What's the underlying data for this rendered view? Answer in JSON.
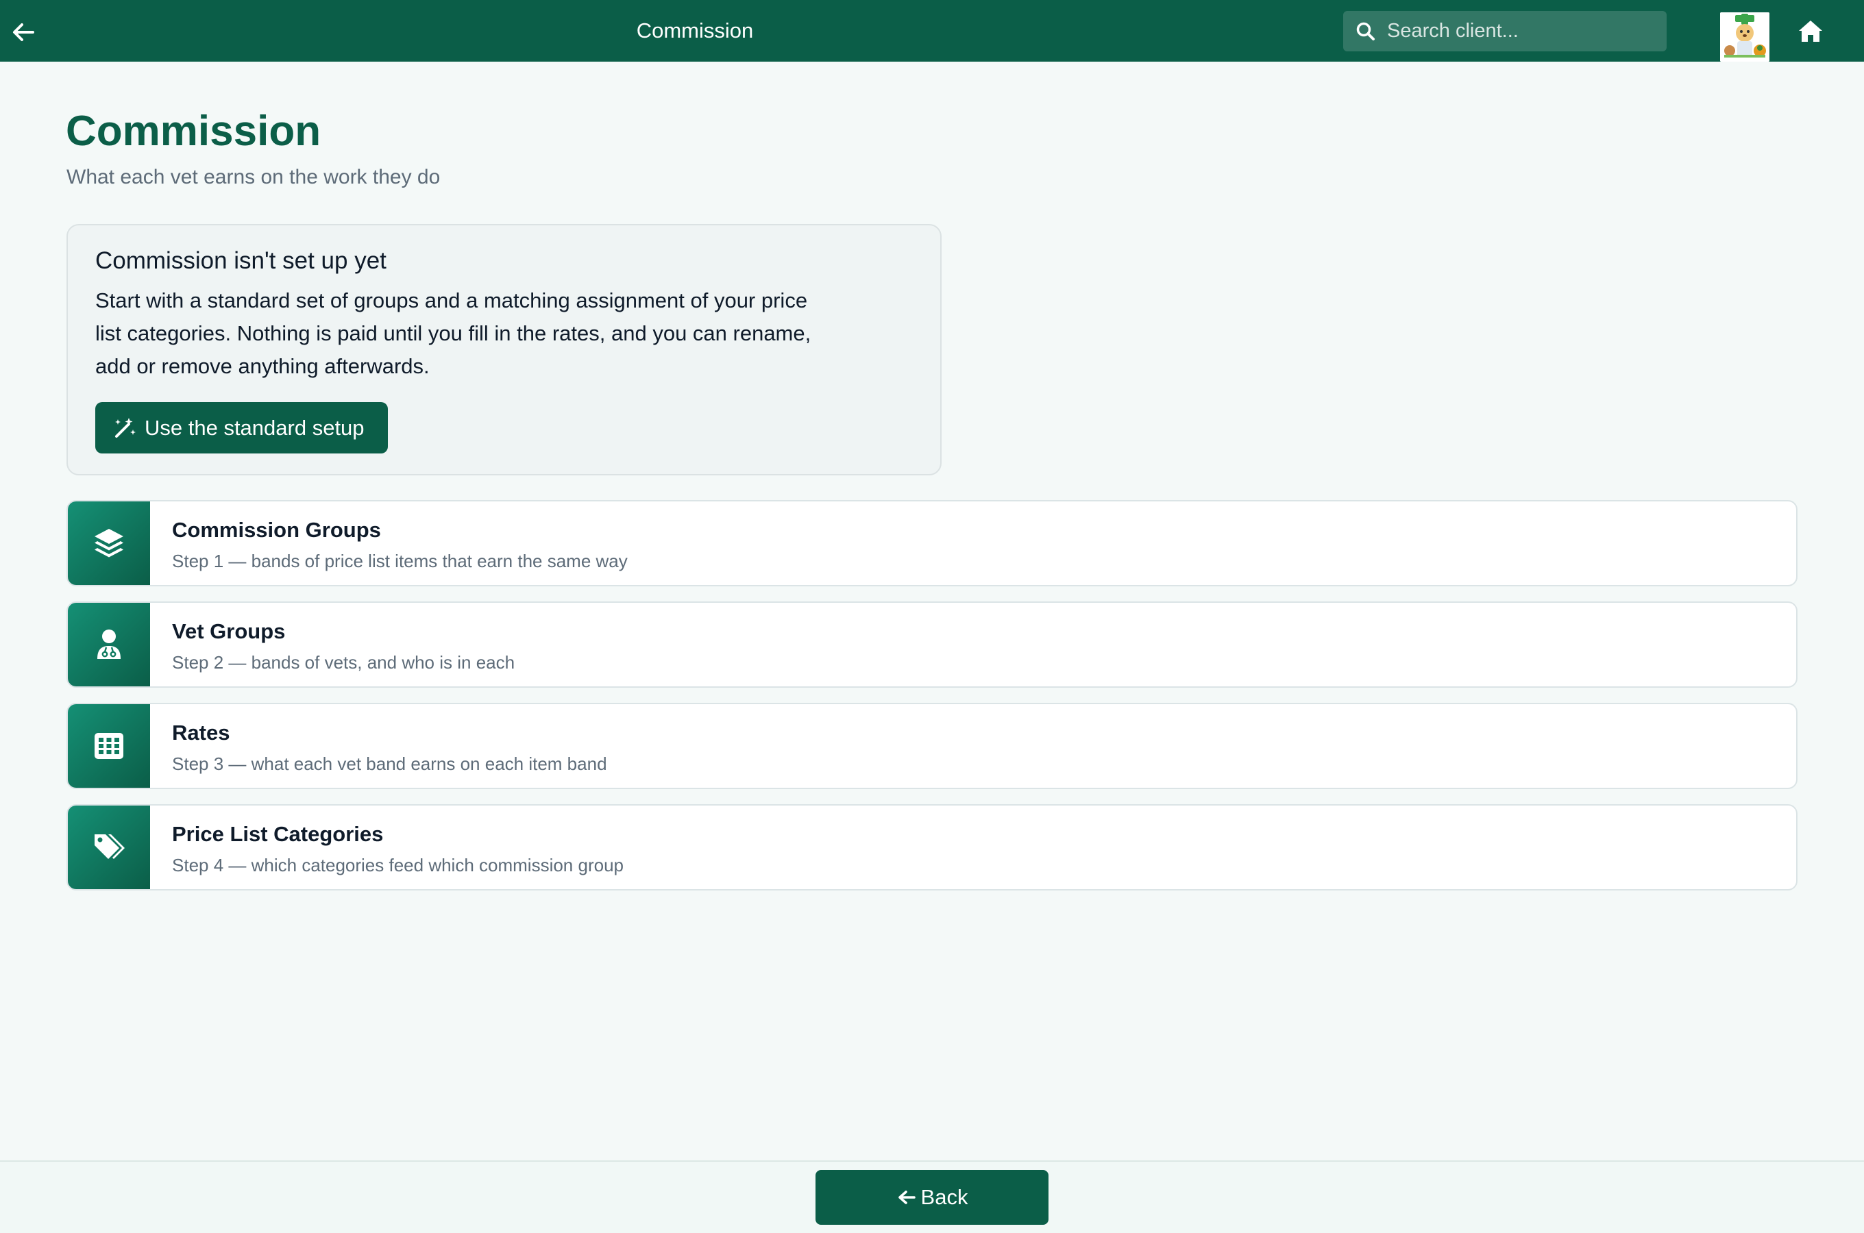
{
  "topbar": {
    "title": "Commission",
    "search_placeholder": "Search client...",
    "back_icon": "arrow-left-icon",
    "home_icon": "home-icon",
    "background": "#0b5e48"
  },
  "page": {
    "title": "Commission",
    "subtitle": "What each vet earns on the work they do"
  },
  "setup_card": {
    "title": "Commission isn't set up yet",
    "description": "Start with a standard set of groups and a matching assignment of your price list categories. Nothing is paid until you fill in the rates, and you can rename, add or remove anything afterwards.",
    "button_label": "Use the standard setup",
    "button_icon": "magic-wand-icon"
  },
  "steps": [
    {
      "title": "Commission Groups",
      "subtitle": "Step 1 — bands of price list items that earn the same way",
      "icon": "layers-icon"
    },
    {
      "title": "Vet Groups",
      "subtitle": "Step 2 — bands of vets, and who is in each",
      "icon": "vet-user-icon"
    },
    {
      "title": "Rates",
      "subtitle": "Step 3 — what each vet band earns on each item band",
      "icon": "grid-icon"
    },
    {
      "title": "Price List Categories",
      "subtitle": "Step 4 — which categories feed which commission group",
      "icon": "tags-icon"
    }
  ],
  "footer": {
    "back_label": "Back"
  },
  "colors": {
    "brand": "#0b5e48",
    "accent": "#159075",
    "page_bg": "#f4f9f8"
  }
}
